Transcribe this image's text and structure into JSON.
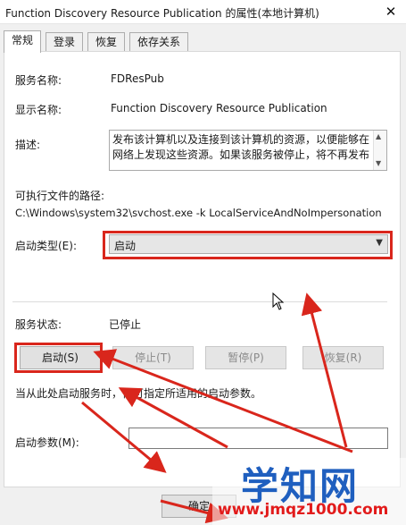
{
  "window": {
    "title": "Function Discovery Resource Publication 的属性(本地计算机)",
    "close_glyph": "✕"
  },
  "tabs": [
    {
      "label": "常规",
      "active": true
    },
    {
      "label": "登录",
      "active": false
    },
    {
      "label": "恢复",
      "active": false
    },
    {
      "label": "依存关系",
      "active": false
    }
  ],
  "general": {
    "service_name_label": "服务名称:",
    "service_name_value": "FDResPub",
    "display_name_label": "显示名称:",
    "display_name_value": "Function Discovery Resource Publication",
    "description_label": "描述:",
    "description_value": "发布该计算机以及连接到该计算机的资源，以便能够在网络上发现这些资源。如果该服务被停止，将不再发布",
    "exe_path_label": "可执行文件的路径:",
    "exe_path_value": "C:\\Windows\\system32\\svchost.exe -k LocalServiceAndNoImpersonation",
    "startup_type_label": "启动类型(E):",
    "startup_type_value": "启动",
    "status_label": "服务状态:",
    "status_value": "已停止",
    "buttons": {
      "start": "启动(S)",
      "stop": "停止(T)",
      "pause": "暂停(P)",
      "resume": "恢复(R)"
    },
    "hint_text": "当从此处启动服务时，你可指定所适用的启动参数。",
    "start_params_label": "启动参数(M):",
    "start_params_value": ""
  },
  "footer": {
    "ok_label": "确定"
  },
  "watermark": {
    "main": "学知网",
    "url": "www.jmqz1000.com"
  },
  "colors": {
    "annotation_red": "#d9261c",
    "watermark_blue": "#1f5fbf",
    "watermark_red": "#e21b1b"
  }
}
